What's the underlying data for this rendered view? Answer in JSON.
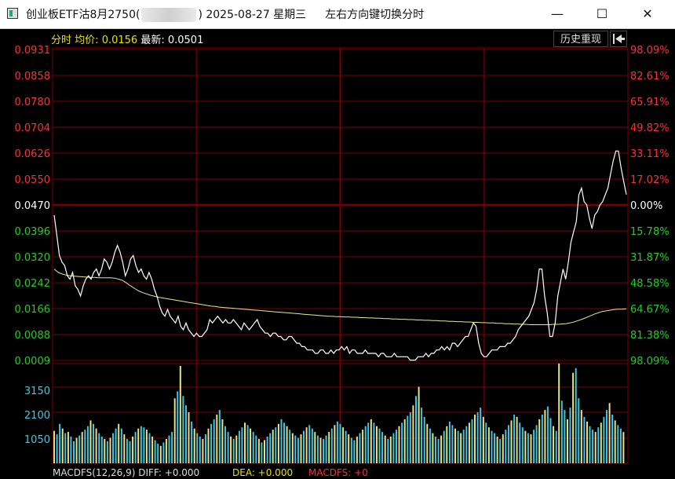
{
  "window": {
    "title_prefix": "创业板ETF沽8月2750(",
    "title_suffix": ") 2025-08-27 星期三",
    "hint": "左右方向键切换分时",
    "minimize_glyph": "—",
    "maximize_glyph": "☐",
    "close_glyph": "✕"
  },
  "info": {
    "mode_label": "分时",
    "avg_label": "均价:",
    "avg_value": "0.0156",
    "latest_label": "最新:",
    "latest_value": "0.0501"
  },
  "buttons": {
    "history": "历史重现",
    "back_glyph": "⇤"
  },
  "macd": {
    "label": "MACDFS(12,26,9) DIFF: +0.000",
    "dea": "DEA: +0.000",
    "macdfs": "MACDFS: +0"
  },
  "colors": {
    "up": "#ff3030",
    "down": "#20d020",
    "grid": "#7a0000",
    "price_line": "#ffffff",
    "avg_line": "#e8e890",
    "vol_cyan": "#40c8e0",
    "vol_yellow": "#e8e880"
  },
  "chart_data": {
    "type": "line",
    "y_left_ticks": [
      "0.0931",
      "0.0858",
      "0.0780",
      "0.0704",
      "0.0626",
      "0.0550",
      "0.0470",
      "0.0396",
      "0.0320",
      "0.0242",
      "0.0166",
      "0.0088",
      "0.0009"
    ],
    "y_right_ticks": [
      "98.09%",
      "82.61%",
      "65.91%",
      "49.82%",
      "33.11%",
      "17.02%",
      "0.00%",
      "15.78%",
      "31.87%",
      "48.58%",
      "64.67%",
      "81.38%",
      "98.09%"
    ],
    "y_range": [
      0.0009,
      0.0931
    ],
    "prev_close": 0.047,
    "volume_ticks": [
      "3150",
      "2100",
      "1050"
    ],
    "volume_range": [
      0,
      4300
    ],
    "series": [
      {
        "values": [
          0.044,
          0.038,
          0.032,
          0.03,
          0.029,
          0.026,
          0.025,
          0.027,
          0.023,
          0.022,
          0.02,
          0.023,
          0.025,
          0.026,
          0.025,
          0.027,
          0.028,
          0.026,
          0.028,
          0.031,
          0.03,
          0.028,
          0.03,
          0.033,
          0.035,
          0.033,
          0.03,
          0.026,
          0.028,
          0.031,
          0.032,
          0.029,
          0.027,
          0.028,
          0.026,
          0.025,
          0.027,
          0.025,
          0.022,
          0.02,
          0.017,
          0.015,
          0.014,
          0.016,
          0.014,
          0.013,
          0.012,
          0.014,
          0.011,
          0.01,
          0.012,
          0.01,
          0.009,
          0.008,
          0.009,
          0.008,
          0.008,
          0.009,
          0.01,
          0.013,
          0.012,
          0.013,
          0.014,
          0.013,
          0.012,
          0.013,
          0.012,
          0.012,
          0.013,
          0.012,
          0.011,
          0.01,
          0.012,
          0.011,
          0.01,
          0.011,
          0.012,
          0.013,
          0.011,
          0.01,
          0.009,
          0.009,
          0.008,
          0.009,
          0.009,
          0.008,
          0.008,
          0.007,
          0.007,
          0.008,
          0.008,
          0.007,
          0.006,
          0.006,
          0.005,
          0.005,
          0.004,
          0.004,
          0.004,
          0.003,
          0.003,
          0.004,
          0.004,
          0.003,
          0.003,
          0.004,
          0.003,
          0.004,
          0.004,
          0.005,
          0.004,
          0.005,
          0.003,
          0.004,
          0.004,
          0.003,
          0.003,
          0.003,
          0.004,
          0.003,
          0.003,
          0.003,
          0.003,
          0.002,
          0.003,
          0.003,
          0.002,
          0.002,
          0.002,
          0.003,
          0.002,
          0.002,
          0.002,
          0.002,
          0.002,
          0.001,
          0.001,
          0.001,
          0.002,
          0.002,
          0.002,
          0.003,
          0.002,
          0.003,
          0.003,
          0.004,
          0.004,
          0.005,
          0.004,
          0.005,
          0.004,
          0.006,
          0.006,
          0.005,
          0.006,
          0.007,
          0.008,
          0.008,
          0.01,
          0.012,
          0.011,
          0.006,
          0.003,
          0.002,
          0.002,
          0.003,
          0.004,
          0.004,
          0.004,
          0.005,
          0.005,
          0.005,
          0.006,
          0.006,
          0.007,
          0.008,
          0.01,
          0.011,
          0.012,
          0.013,
          0.014,
          0.016,
          0.018,
          0.022,
          0.028,
          0.028,
          0.02,
          0.015,
          0.008,
          0.008,
          0.012,
          0.02,
          0.024,
          0.028,
          0.025,
          0.03,
          0.036,
          0.039,
          0.042,
          0.05,
          0.052,
          0.048,
          0.047,
          0.043,
          0.04,
          0.044,
          0.045,
          0.047,
          0.048,
          0.05,
          0.052,
          0.056,
          0.06,
          0.063,
          0.063,
          0.058,
          0.054,
          0.0501
        ]
      },
      {
        "values": [
          0.028,
          0.027,
          0.0265,
          0.0262,
          0.026,
          0.0259,
          0.0258,
          0.0257,
          0.0256,
          0.0255,
          0.0255,
          0.0254,
          0.0254,
          0.0254,
          0.0254,
          0.0253,
          0.025,
          0.0246,
          0.0238,
          0.023,
          0.0222,
          0.0215,
          0.021,
          0.0206,
          0.0202,
          0.0199,
          0.0196,
          0.0194,
          0.0192,
          0.019,
          0.0188,
          0.0186,
          0.0184,
          0.0182,
          0.018,
          0.0178,
          0.0176,
          0.0174,
          0.0172,
          0.017,
          0.0169,
          0.0167,
          0.0166,
          0.0165,
          0.0164,
          0.0163,
          0.0162,
          0.0161,
          0.016,
          0.0159,
          0.0158,
          0.0157,
          0.0156,
          0.0155,
          0.0154,
          0.0153,
          0.0152,
          0.0151,
          0.015,
          0.0149,
          0.0148,
          0.0147,
          0.0146,
          0.0145,
          0.0144,
          0.0143,
          0.0142,
          0.0141,
          0.014,
          0.014,
          0.0139,
          0.0139,
          0.0138,
          0.0138,
          0.0137,
          0.0137,
          0.0136,
          0.0136,
          0.0135,
          0.0135,
          0.0134,
          0.0134,
          0.0133,
          0.0133,
          0.0132,
          0.0132,
          0.0131,
          0.0131,
          0.013,
          0.013,
          0.0129,
          0.0129,
          0.0128,
          0.0128,
          0.0127,
          0.0127,
          0.0126,
          0.0126,
          0.0125,
          0.0125,
          0.0124,
          0.0124,
          0.0123,
          0.0123,
          0.0122,
          0.0122,
          0.0121,
          0.0121,
          0.012,
          0.012,
          0.0119,
          0.0119,
          0.0118,
          0.0118,
          0.0117,
          0.0117,
          0.0116,
          0.0116,
          0.0115,
          0.0115,
          0.0115,
          0.0115,
          0.0115,
          0.0115,
          0.0116,
          0.0116,
          0.0117,
          0.0118,
          0.012,
          0.0123,
          0.0127,
          0.0131,
          0.0136,
          0.0141,
          0.0146,
          0.015,
          0.0154,
          0.0156,
          0.0158,
          0.016,
          0.0161,
          0.0161,
          0.0162
        ]
      }
    ],
    "volumes": [
      1400,
      1250,
      1700,
      1500,
      1300,
      1350,
      1150,
      950,
      1100,
      1200,
      1350,
      1450,
      1600,
      1850,
      1700,
      1500,
      1300,
      1150,
      1050,
      950,
      1100,
      1300,
      1500,
      1700,
      1500,
      1250,
      1050,
      950,
      1150,
      1350,
      1500,
      1600,
      1550,
      1450,
      1300,
      1150,
      1000,
      850,
      750,
      900,
      1050,
      1200,
      1350,
      2800,
      3100,
      4200,
      2900,
      2500,
      2200,
      1800,
      1500,
      1300,
      1150,
      1050,
      1250,
      1500,
      1700,
      1900,
      2100,
      2300,
      1900,
      1600,
      1350,
      1150,
      1050,
      1200,
      1400,
      1550,
      1750,
      1650,
      1500,
      1350,
      1200,
      1050,
      900,
      1000,
      1150,
      1300,
      1450,
      1550,
      1700,
      1900,
      1750,
      1600,
      1450,
      1300,
      1200,
      1100,
      1250,
      1400,
      1550,
      1650,
      1500,
      1350,
      1200,
      1100,
      1050,
      1200,
      1350,
      1500,
      1650,
      1800,
      1700,
      1550,
      1400,
      1250,
      1100,
      1000,
      1150,
      1300,
      1450,
      1600,
      1750,
      1900,
      1750,
      1600,
      1500,
      1350,
      1200,
      1050,
      1150,
      1300,
      1450,
      1600,
      1750,
      1900,
      2050,
      2200,
      2500,
      2900,
      3300,
      2400,
      2000,
      1700,
      1500,
      1300,
      1150,
      1050,
      1200,
      1400,
      1600,
      1800,
      1650,
      1500,
      1400,
      1300,
      1450,
      1600,
      1750,
      1900,
      2100,
      2200,
      2400,
      2000,
      1750,
      1550,
      1400,
      1300,
      1150,
      1050,
      1250,
      1450,
      1650,
      1850,
      2100,
      2000,
      1750,
      1550,
      1400,
      1300,
      1250,
      1450,
      1650,
      1900,
      2100,
      2300,
      2450,
      1950,
      1600,
      1400,
      4300,
      2700,
      2300,
      1900,
      2400,
      3900,
      4100,
      2800,
      2300,
      2000,
      1800,
      1600,
      1450,
      1350,
      1550,
      1750,
      2000,
      2300,
      2600,
      2100,
      1850,
      1650,
      1500,
      1350
    ]
  }
}
